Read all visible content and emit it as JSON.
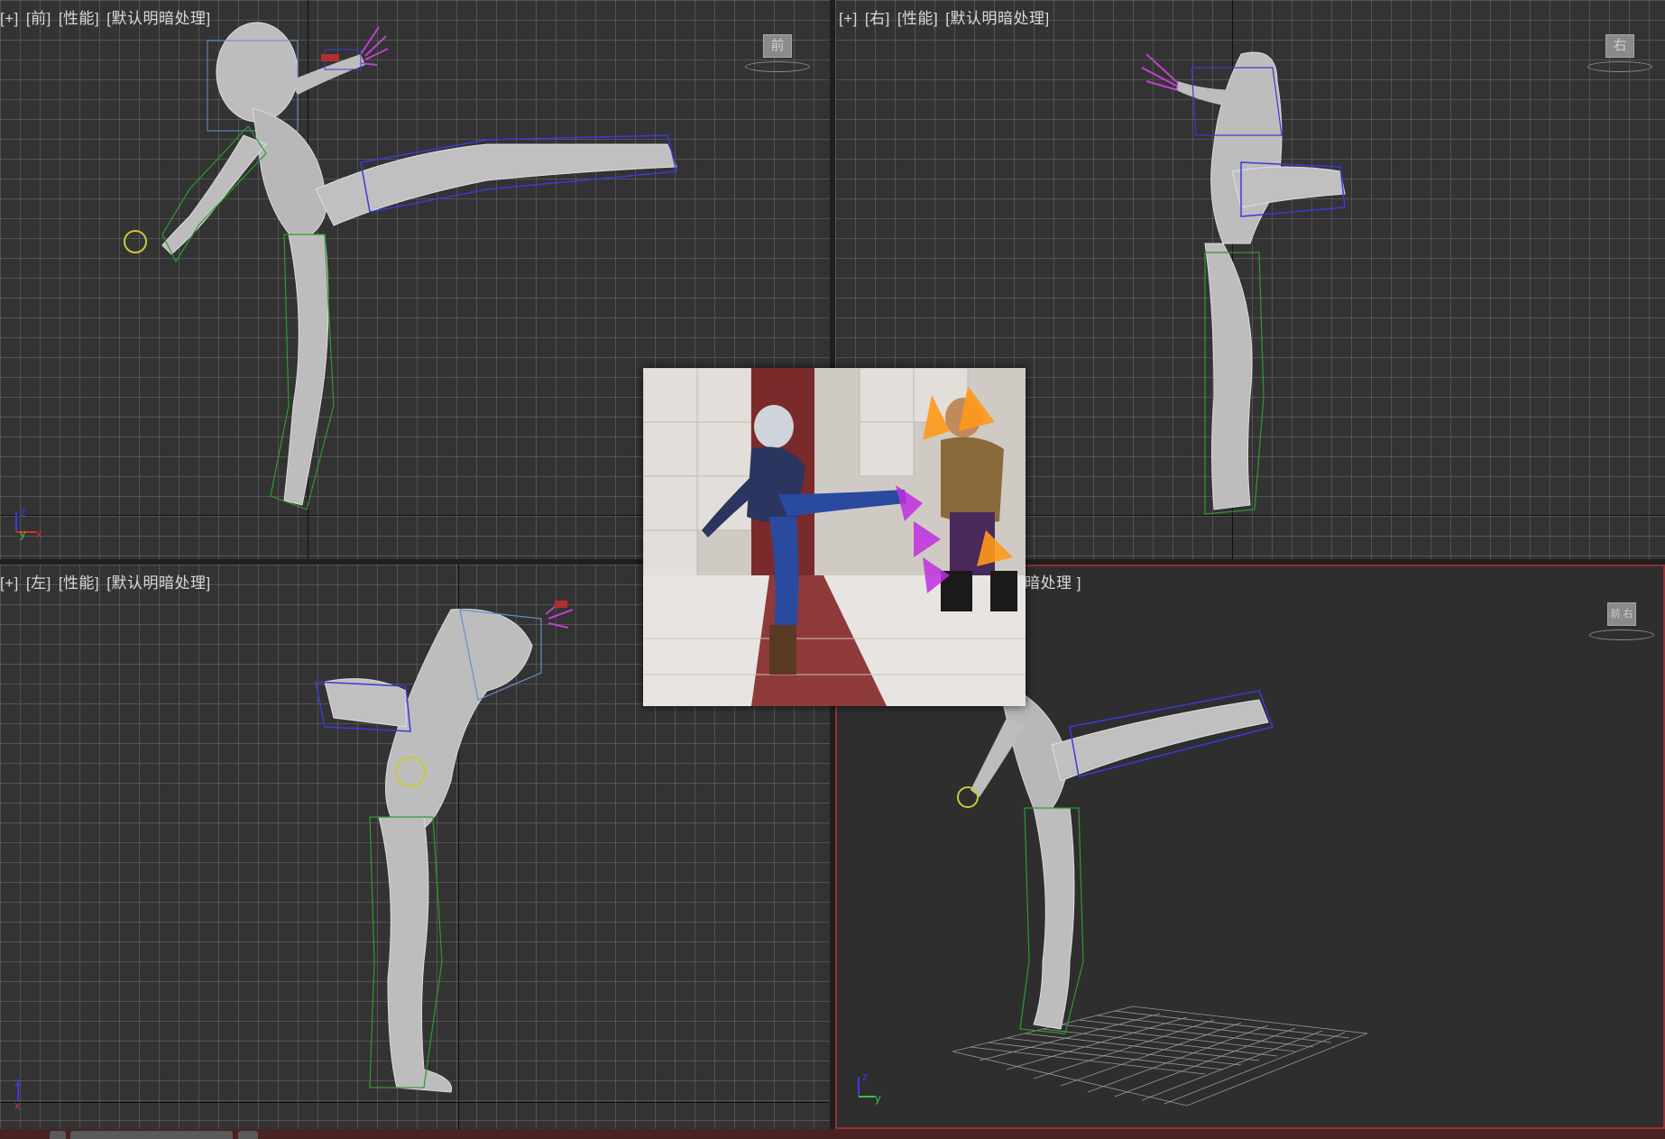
{
  "viewports": {
    "front": {
      "labels": [
        "[+]",
        "[前]",
        "[性能]",
        "[默认明暗处理]"
      ],
      "cube_face": "前",
      "axis_y": "y",
      "axis_x": "x",
      "axis_z": "z"
    },
    "right": {
      "labels": [
        "[+]",
        "[右]",
        "[性能]",
        "[默认明暗处理]"
      ],
      "cube_face": "右"
    },
    "left": {
      "labels": [
        "[+]",
        "[左]",
        "[性能]",
        "[默认明暗处理]"
      ],
      "axis_z": "z",
      "axis_x": "x"
    },
    "perspective": {
      "label_visible": "暗处理 ]",
      "cube_face": "前 右",
      "axis_z": "z",
      "axis_y": "y"
    }
  },
  "colors": {
    "grid": "#787878",
    "viewport_bg": "#333333",
    "active_border": "#9b2f2f",
    "bone_blue": "#3a3ad8",
    "bone_green": "#2e9b2e",
    "hand_magenta": "#c040d0",
    "hand_yellow": "#c8c83a",
    "mesh_gray": "#bdbdbd"
  }
}
